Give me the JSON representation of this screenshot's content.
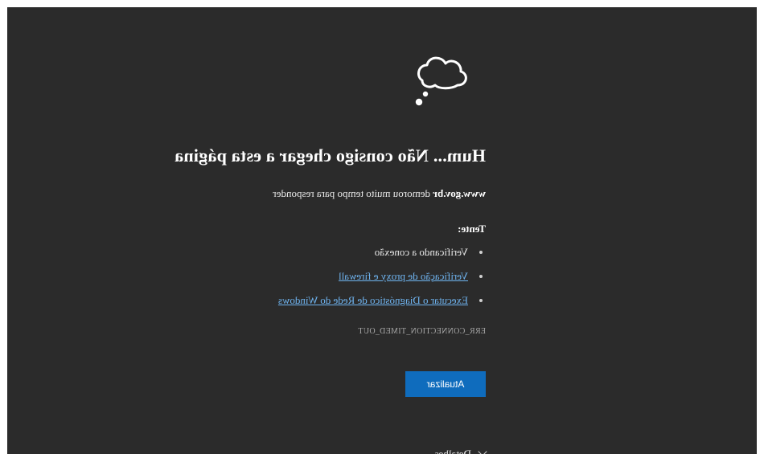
{
  "error_page": {
    "heading": "Hum... Não consigo chegar a esta página",
    "domain": "www.gov.br",
    "subtitle_rest": " demorou muito tempo para responder",
    "try_label": "Tente:",
    "suggestions": [
      {
        "label": "Verificando a conexão",
        "is_link": false
      },
      {
        "label": "Verificação de proxy e firewall",
        "is_link": true
      },
      {
        "label": "Executar o Diagnóstico de Rede do Windows",
        "is_link": true
      }
    ],
    "error_code": "ERR_CONNECTION_TIMED_OUT",
    "refresh_label": "Atualizar",
    "details_label": "Detalhes"
  },
  "colors": {
    "background": "#2b2b2b",
    "accent": "#0f6cbd",
    "link": "#6fb4f0"
  },
  "icons": {
    "illustration": "cloud-icon",
    "details": "chevron-down-icon"
  }
}
